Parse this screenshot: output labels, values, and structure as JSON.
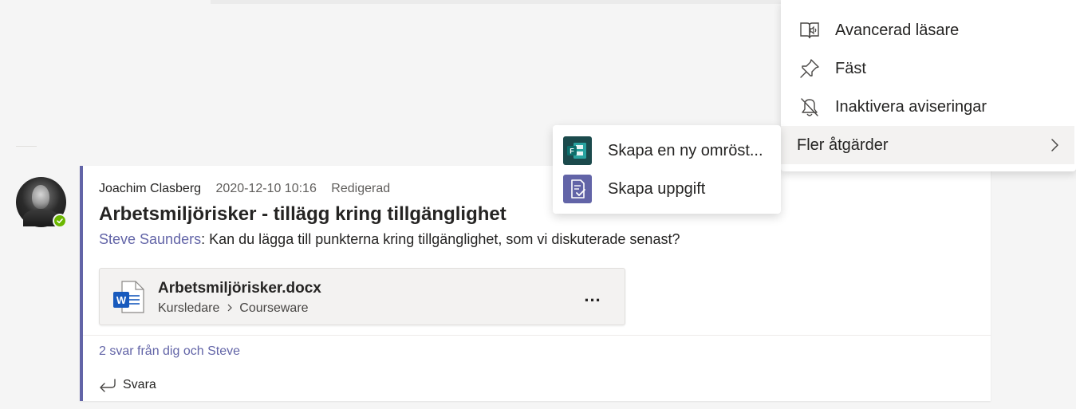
{
  "message": {
    "author": "Joachim Clasberg",
    "timestamp": "2020-12-10 10:16",
    "edited_label": "Redigerad",
    "subject": "Arbetsmiljörisker - tillägg kring tillgänglighet",
    "mention": "Steve Saunders",
    "mention_sep": ":",
    "body": " Kan du lägga till punkterna kring tillgänglighet, som vi diskuterade senast?",
    "attachment": {
      "file_name": "Arbetsmiljörisker.docx",
      "path_root": "Kursledare",
      "path_child": "Courseware",
      "more_label": "..."
    },
    "replies_link": "2 svar från dig och Steve",
    "reply_label": "Svara"
  },
  "context_menu": {
    "items": [
      {
        "label": "Avancerad läsare",
        "icon": "immersive-reader-icon"
      },
      {
        "label": "Fäst",
        "icon": "pin-icon"
      },
      {
        "label": "Inaktivera aviseringar",
        "icon": "bell-off-icon"
      },
      {
        "label": "Fler åtgärder",
        "icon": "chevron-right-icon"
      }
    ]
  },
  "submenu": {
    "items": [
      {
        "label": "Skapa en ny omröst...",
        "icon": "forms-app-icon"
      },
      {
        "label": "Skapa uppgift",
        "icon": "assignments-app-icon"
      }
    ]
  },
  "colors": {
    "accent": "#6264a7",
    "presence": "#6bb700",
    "forms": "#035a5c",
    "assignments": "#6264a7",
    "word": "#185abd"
  }
}
